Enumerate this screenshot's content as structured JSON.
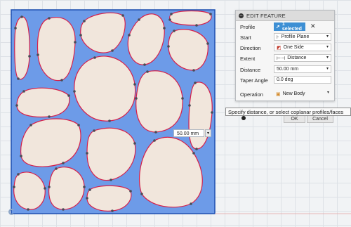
{
  "panel": {
    "title": "EDIT FEATURE",
    "rows": {
      "profile": {
        "label": "Profile",
        "value": "1 selected"
      },
      "start": {
        "label": "Start",
        "value": "Profile Plane"
      },
      "direction": {
        "label": "Direction",
        "value": "One Side"
      },
      "extent": {
        "label": "Extent",
        "value": "Distance"
      },
      "distance": {
        "label": "Distance",
        "value": "50.00 mm"
      },
      "taper": {
        "label": "Taper Angle",
        "value": "0.0 deg"
      },
      "operation": {
        "label": "Operation",
        "value": "New Body"
      }
    },
    "ok_label": "OK",
    "cancel_label": "Cancel"
  },
  "tooltip": "Specify distance, or select coplanar profiles/faces",
  "canvas_input": {
    "value": "50.00 mm"
  },
  "colors": {
    "plate_fill": "#6d9be8",
    "plate_border": "#1e4fb0",
    "hole_fill": "#f1e6dc",
    "hole_border": "#d6204a",
    "selected_button": "#3d8fd4"
  }
}
